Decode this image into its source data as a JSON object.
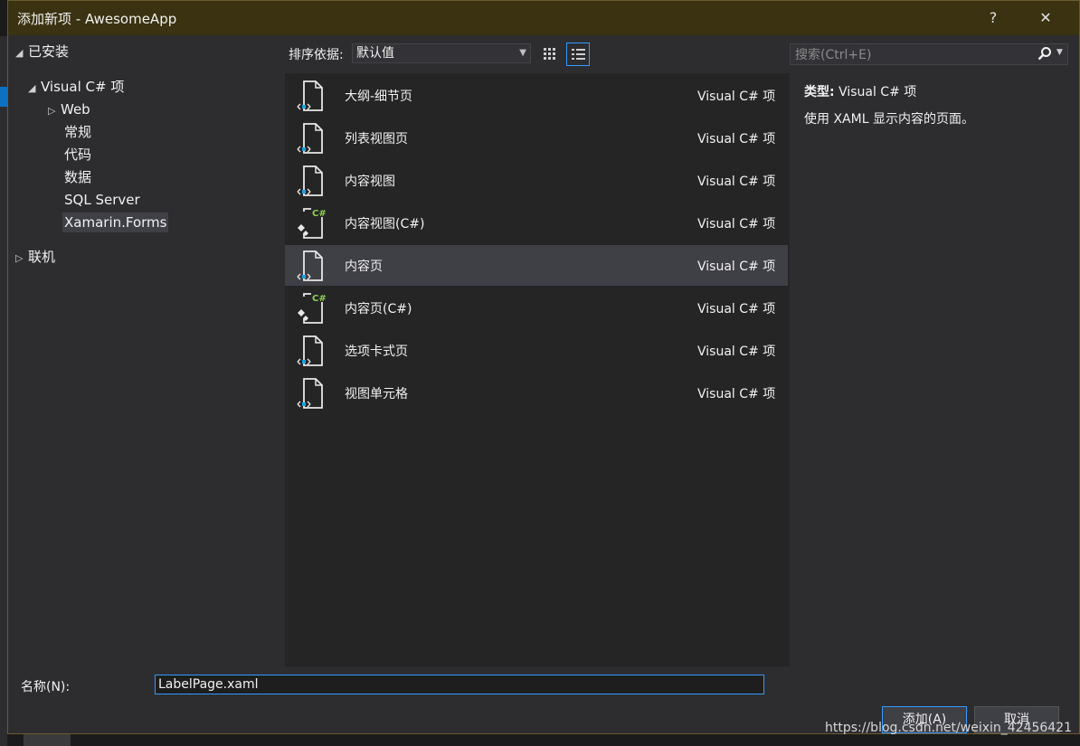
{
  "window": {
    "title": "添加新项 - AwesomeApp",
    "help": "?",
    "close": "✕"
  },
  "tree": {
    "installed": "已安装",
    "visual_cs": "Visual C# 项",
    "children": [
      "Web",
      "常规",
      "代码",
      "数据",
      "SQL Server",
      "Xamarin.Forms"
    ],
    "selected": "Xamarin.Forms",
    "online": "联机"
  },
  "toolbar": {
    "sort_label": "排序依据:",
    "sort_value": "默认值"
  },
  "search": {
    "placeholder": "搜索(Ctrl+E)"
  },
  "templates": [
    {
      "name": "大纲-细节页",
      "type": "Visual C# 项",
      "icon": "xaml-page-icon"
    },
    {
      "name": "列表视图页",
      "type": "Visual C# 项",
      "icon": "xaml-page-icon"
    },
    {
      "name": "内容视图",
      "type": "Visual C# 项",
      "icon": "xaml-page-icon"
    },
    {
      "name": "内容视图(C#)",
      "type": "Visual C# 项",
      "icon": "csharp-file-icon"
    },
    {
      "name": "内容页",
      "type": "Visual C# 项",
      "icon": "xaml-page-icon",
      "selected": true
    },
    {
      "name": "内容页(C#)",
      "type": "Visual C# 项",
      "icon": "csharp-file-icon"
    },
    {
      "name": "选项卡式页",
      "type": "Visual C# 项",
      "icon": "xaml-page-icon"
    },
    {
      "name": "视图单元格",
      "type": "Visual C# 项",
      "icon": "xaml-page-icon"
    }
  ],
  "detail": {
    "type_label": "类型:",
    "type_value": "Visual C# 项",
    "description": "使用 XAML 显示内容的页面。"
  },
  "footer": {
    "name_label": "名称(N):",
    "name_value": "LabelPage.xaml",
    "add_button": "添加(A)",
    "cancel_button": "取消"
  },
  "watermark": "https://blog.csdn.net/weixin_42456421",
  "colors": {
    "accent": "#3399ff",
    "titlebar": "#3a3210",
    "list_bg": "#252526",
    "dialog_bg": "#2d2d30"
  }
}
